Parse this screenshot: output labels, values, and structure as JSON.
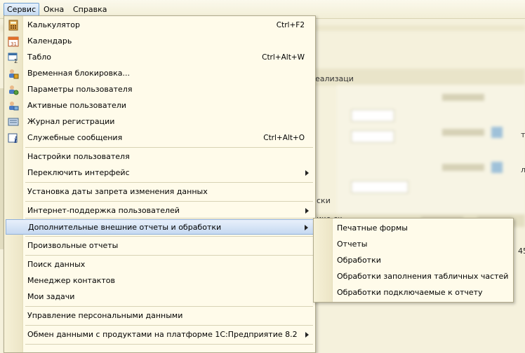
{
  "menubar": {
    "items": [
      {
        "label": "Сервис"
      },
      {
        "label": "Окна"
      },
      {
        "label": "Справка"
      }
    ]
  },
  "background": {
    "toolbar_fragment": "еализаци",
    "fragment_2": "ски",
    "fragment_3": "ико ск",
    "fragment_4": "45",
    "fragment_5": "л",
    "fragment_6": "т"
  },
  "menu": {
    "items": [
      {
        "label": "Калькулятор",
        "shortcut": "Ctrl+F2",
        "icon": "calculator-icon"
      },
      {
        "label": "Календарь",
        "shortcut": "",
        "icon": "calendar-icon"
      },
      {
        "label": "Табло",
        "shortcut": "Ctrl+Alt+W",
        "icon": "scoreboard-icon"
      },
      {
        "label": "Временная блокировка...",
        "shortcut": "",
        "icon": "lock-user-icon"
      },
      {
        "label": "Параметры пользователя",
        "shortcut": "",
        "icon": "user-settings-icon"
      },
      {
        "label": "Активные пользователи",
        "shortcut": "",
        "icon": "active-users-icon"
      },
      {
        "label": "Журнал регистрации",
        "shortcut": "",
        "icon": "journal-icon"
      },
      {
        "label": "Служебные сообщения",
        "shortcut": "Ctrl+Alt+O",
        "icon": "info-message-icon"
      },
      {
        "label": "Настройки пользователя",
        "shortcut": ""
      },
      {
        "label": "Переключить интерфейс",
        "shortcut": ""
      },
      {
        "label": "Установка даты запрета изменения данных",
        "shortcut": ""
      },
      {
        "label": "Интернет-поддержка пользователей",
        "shortcut": ""
      },
      {
        "label": "Дополнительные внешние отчеты и обработки",
        "shortcut": ""
      },
      {
        "label": "Произвольные отчеты",
        "shortcut": ""
      },
      {
        "label": "Поиск данных",
        "shortcut": ""
      },
      {
        "label": "Менеджер контактов",
        "shortcut": ""
      },
      {
        "label": "Мои задачи",
        "shortcut": ""
      },
      {
        "label": "Управление персональными данными",
        "shortcut": ""
      },
      {
        "label": "Обмен данными с продуктами на платформе 1С:Предприятие 8.2",
        "shortcut": ""
      }
    ]
  },
  "submenu": {
    "items": [
      {
        "label": "Печатные формы"
      },
      {
        "label": "Отчеты"
      },
      {
        "label": "Обработки"
      },
      {
        "label": "Обработки заполнения табличных частей"
      },
      {
        "label": "Обработки подключаемые к отчету"
      }
    ]
  },
  "colors": {
    "menu_bg": "#fffbea",
    "highlight": "#c6d9f1",
    "highlight_border": "#8fb0da",
    "shortcut_text": "#000000"
  }
}
